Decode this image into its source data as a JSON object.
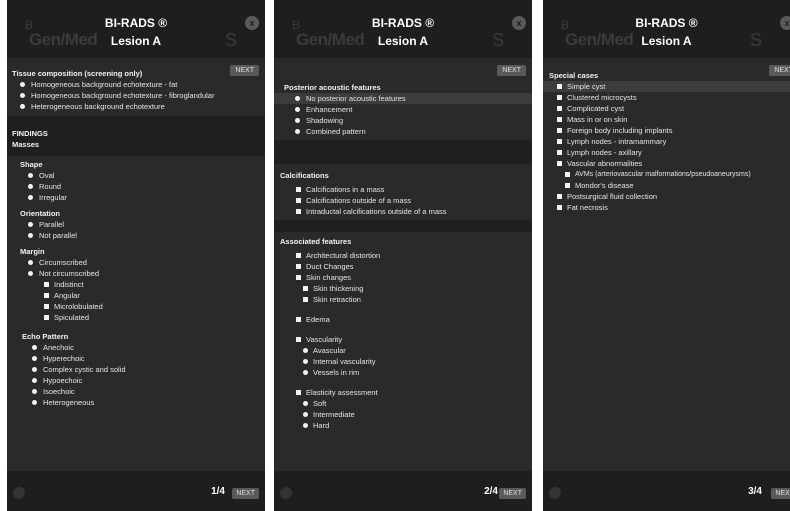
{
  "header": {
    "title": "BI-RADS ®",
    "subtitle": "Lesion A",
    "close": "x",
    "logo_b": "B",
    "logo_text": "Gen/Med",
    "logo_s": "S"
  },
  "buttons": {
    "next": "NEXT"
  },
  "panel1": {
    "tissue_title": "Tissue composition (screening only)",
    "tissue": [
      "Homogeneous background echotexture - fat",
      "Homogeneous background echotexture - fibroglandular",
      "Heterogeneous background echotexture"
    ],
    "findings": "FINDINGS",
    "masses": "Masses",
    "shape_title": "Shape",
    "shape": [
      "Oval",
      "Round",
      "Irregular"
    ],
    "orientation_title": "Orientation",
    "orientation": [
      "Parallel",
      "Not parallel"
    ],
    "margin_title": "Margin",
    "margin": [
      "Circumscribed",
      "Not circumscribed"
    ],
    "margin_sub": [
      "Indistinct",
      "Angular",
      "Microlobulated",
      "Spiculated"
    ],
    "echo_title": "Echo Pattern",
    "echo": [
      "Anechoic",
      "Hyperechoic",
      "Complex cystic and solid",
      "Hypoechoic",
      "Isoechoic",
      "Heterogeneous"
    ],
    "page": "1/4"
  },
  "panel2": {
    "posterior_title": "Posterior acoustic features",
    "posterior": [
      "No posterior acoustic features",
      "Enhancement",
      "Shadowing",
      "Combined pattern"
    ],
    "calc_title": "Calcifications",
    "calc": [
      "Calcifications in a mass",
      "Calcifications outside of a mass",
      "Intraductal calcifications outside of a mass"
    ],
    "assoc_title": "Associated features",
    "assoc": [
      "Architectural distortion",
      "Duct Changes",
      "Skin changes"
    ],
    "skin_sub": [
      "Skin thickening",
      "Skin retraction"
    ],
    "edema": "Edema",
    "vascularity": "Vascularity",
    "vasc_sub": [
      "Avascular",
      "Internal vascularity",
      "Vessels in rim"
    ],
    "elasticity": "Elasticity assessment",
    "elast_sub": [
      "Soft",
      "Intermediate",
      "Hard"
    ],
    "page": "2/4"
  },
  "panel3": {
    "special_title": "Special cases",
    "special": [
      "Simple cyst",
      "Clustered microcysts",
      "Complicated cyst",
      "Mass in or on skin",
      "Foreign body including implants",
      "Lymph nodes - intramammary",
      "Lymph nodes - axillary",
      "Vascular abnormalities"
    ],
    "vascular_sub": [
      "AVMs (arteriovascular malformations/pseudoaneurysms)",
      "Mondor's disease"
    ],
    "special_after": [
      "Postsurgical fluid collection",
      "Fat necrosis"
    ],
    "page": "3/4"
  }
}
